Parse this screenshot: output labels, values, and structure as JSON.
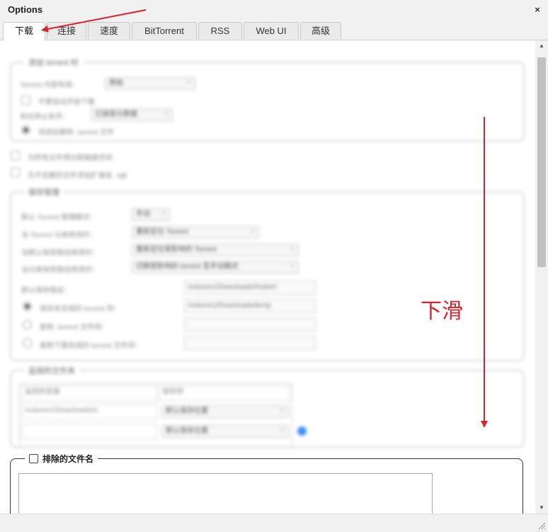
{
  "window": {
    "title": "Options",
    "close_label": "×"
  },
  "tabs": [
    {
      "label": "下载",
      "active": true
    },
    {
      "label": "连接"
    },
    {
      "label": "速度"
    },
    {
      "label": "BitTorrent"
    },
    {
      "label": "RSS"
    },
    {
      "label": "Web UI"
    },
    {
      "label": "高级"
    }
  ],
  "blurred": {
    "fs1": {
      "legend": "添加 torrent 时",
      "rows": [
        "Torrent 内容布局：",
        "不要自动开始下载",
        "到达停止条件：",
        "完成后删除 .torrent 文件"
      ],
      "select1": "原始",
      "select2": "已接受元数据"
    },
    "loose": [
      "为所有文件预分配磁盘空间",
      "为不完整的文件添加扩展名 .!qB"
    ],
    "fs2": {
      "legend": "保存管理",
      "rows": [
        "默认 Torrent 管理模式：",
        "当 Torrent 分类修改时：",
        "当默认保存路径修改时：",
        "当分类保存路径修改时：",
        "默认保存路径：",
        "保存未完成的 torrent 到：",
        "复制 .torrent 文件到：",
        "复制下载完成的 torrent 文件到："
      ],
      "selects": [
        "手动",
        "重新定位 Torrent",
        "重新定位受影响的 Torrent",
        "切换受影响的 torrent 至手动模式"
      ],
      "inputs": [
        "/volume1/Downloads/Hubert",
        "/volume1/Downloads/temp"
      ]
    },
    "fs3": {
      "legend": "监视的文件夹",
      "headers": [
        "监控的目录",
        "保存到"
      ],
      "row1": [
        "/volume1/Downloads/tv",
        "默认保存位置"
      ],
      "row2": [
        "",
        "默认保存位置"
      ]
    }
  },
  "excluded": {
    "label": "排除的文件名",
    "value": ""
  },
  "annotation": {
    "text": "下滑",
    "color": "#d9222a"
  },
  "scrollbar": {
    "position": 0.0
  }
}
